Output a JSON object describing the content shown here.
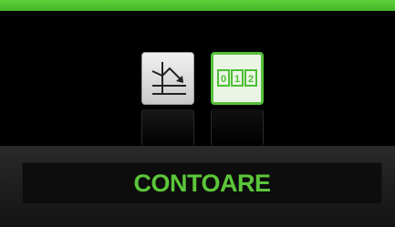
{
  "header": {
    "accent_color": "#4cbf33"
  },
  "toolbar": {
    "buttons": [
      {
        "icon": "trend-chart-icon",
        "selected": false
      },
      {
        "icon": "counter-digits-icon",
        "selected": true,
        "digits": [
          "0",
          "1",
          "2"
        ]
      }
    ]
  },
  "footer": {
    "section_label": "CONTOARE",
    "label_color": "#5cc63a"
  }
}
